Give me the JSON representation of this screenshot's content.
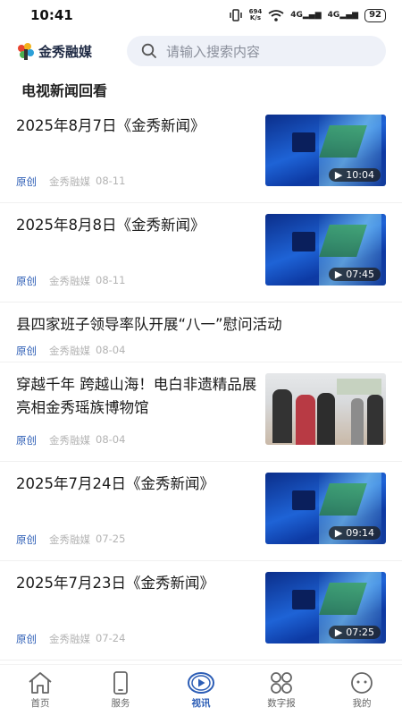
{
  "status_bar": {
    "time": "10:41",
    "net_speed_value": "694",
    "net_speed_unit": "K/s",
    "signal1": "4G",
    "signal2": "4G",
    "battery": "92"
  },
  "header": {
    "logo_text": "金秀融媒",
    "search_placeholder": "请输入搜索内容"
  },
  "section_title": "电视新闻回看",
  "news": [
    {
      "title": "2025年8月7日《金秀新闻》",
      "tag": "原创",
      "source": "金秀融媒",
      "date": "08-11",
      "duration": "10:04",
      "thumb": "video"
    },
    {
      "title": "2025年8月8日《金秀新闻》",
      "tag": "原创",
      "source": "金秀融媒",
      "date": "08-11",
      "duration": "07:45",
      "thumb": "video"
    },
    {
      "title": "县四家班子领导率队开展“八一”慰问活动",
      "tag": "原创",
      "source": "金秀融媒",
      "date": "08-04",
      "thumb": "none"
    },
    {
      "title": "穿越千年 跨越山海！电白非遗精品展亮相金秀瑶族博物馆",
      "tag": "原创",
      "source": "金秀融媒",
      "date": "08-04",
      "thumb": "photo"
    },
    {
      "title": "2025年7月24日《金秀新闻》",
      "tag": "原创",
      "source": "金秀融媒",
      "date": "07-25",
      "duration": "09:14",
      "thumb": "video"
    },
    {
      "title": "2025年7月23日《金秀新闻》",
      "tag": "原创",
      "source": "金秀融媒",
      "date": "07-24",
      "duration": "07:25",
      "thumb": "video"
    }
  ],
  "tabs": [
    {
      "label": "首页",
      "icon": "home-icon",
      "active": false
    },
    {
      "label": "服务",
      "icon": "phone-icon",
      "active": false
    },
    {
      "label": "视讯",
      "icon": "play-icon",
      "active": true
    },
    {
      "label": "数字报",
      "icon": "grid-icon",
      "active": false
    },
    {
      "label": "我的",
      "icon": "profile-icon",
      "active": false
    }
  ],
  "colors": {
    "accent": "#2d5eb6",
    "search_bg": "#eef1f8",
    "meta_gray": "#b3b3b3"
  }
}
